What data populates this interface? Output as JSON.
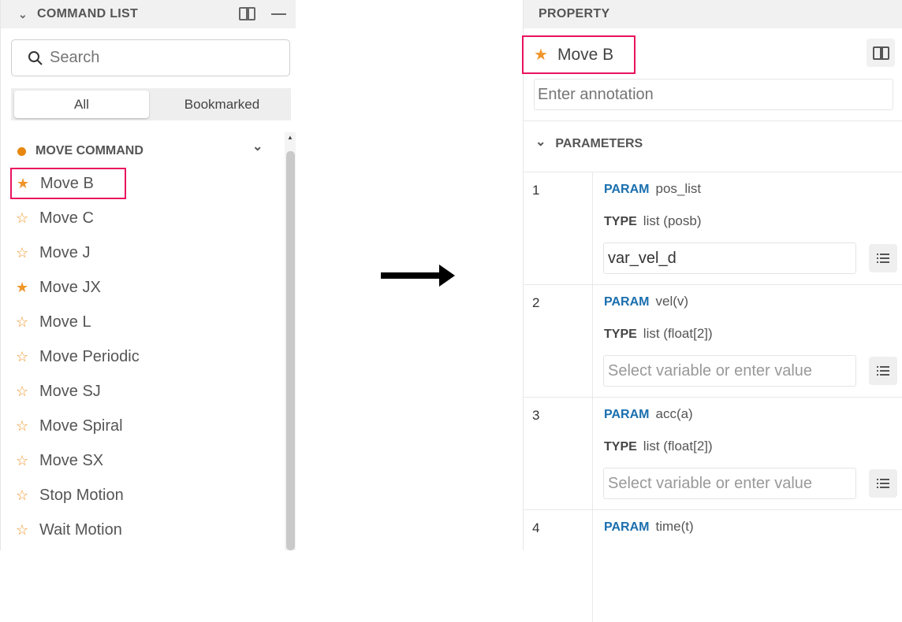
{
  "command_list": {
    "title": "COMMAND LIST",
    "search_placeholder": "Search",
    "tabs": [
      "All",
      "Bookmarked"
    ],
    "active_tab": "All",
    "section": {
      "title": "MOVE COMMAND",
      "color": "#e8870e"
    },
    "items": [
      {
        "label": "Move B",
        "bookmarked": true,
        "highlighted": true
      },
      {
        "label": "Move C",
        "bookmarked": false
      },
      {
        "label": "Move J",
        "bookmarked": false
      },
      {
        "label": "Move JX",
        "bookmarked": true
      },
      {
        "label": "Move L",
        "bookmarked": false
      },
      {
        "label": "Move Periodic",
        "bookmarked": false
      },
      {
        "label": "Move SJ",
        "bookmarked": false
      },
      {
        "label": "Move Spiral",
        "bookmarked": false
      },
      {
        "label": "Move SX",
        "bookmarked": false
      },
      {
        "label": "Stop Motion",
        "bookmarked": false
      },
      {
        "label": "Wait Motion",
        "bookmarked": false
      }
    ]
  },
  "property": {
    "title": "PROPERTY",
    "command": "Move B",
    "annotation_placeholder": "Enter annotation",
    "parameters_title": "PARAMETERS",
    "param_kw": "PARAM",
    "type_kw": "TYPE",
    "params": [
      {
        "num": "1",
        "name": "pos_list",
        "type": "list (posb)",
        "value": "var_vel_d",
        "placeholder": ""
      },
      {
        "num": "2",
        "name": "vel(v)",
        "type": "list (float[2])",
        "value": "",
        "placeholder": "Select variable or enter value"
      },
      {
        "num": "3",
        "name": "acc(a)",
        "type": "list (float[2])",
        "value": "",
        "placeholder": "Select variable or enter value"
      },
      {
        "num": "4",
        "name": "time(t)"
      }
    ]
  },
  "colors": {
    "accent_blue": "#1a6fae",
    "star": "#f0952a",
    "highlight": "#e8135e"
  }
}
